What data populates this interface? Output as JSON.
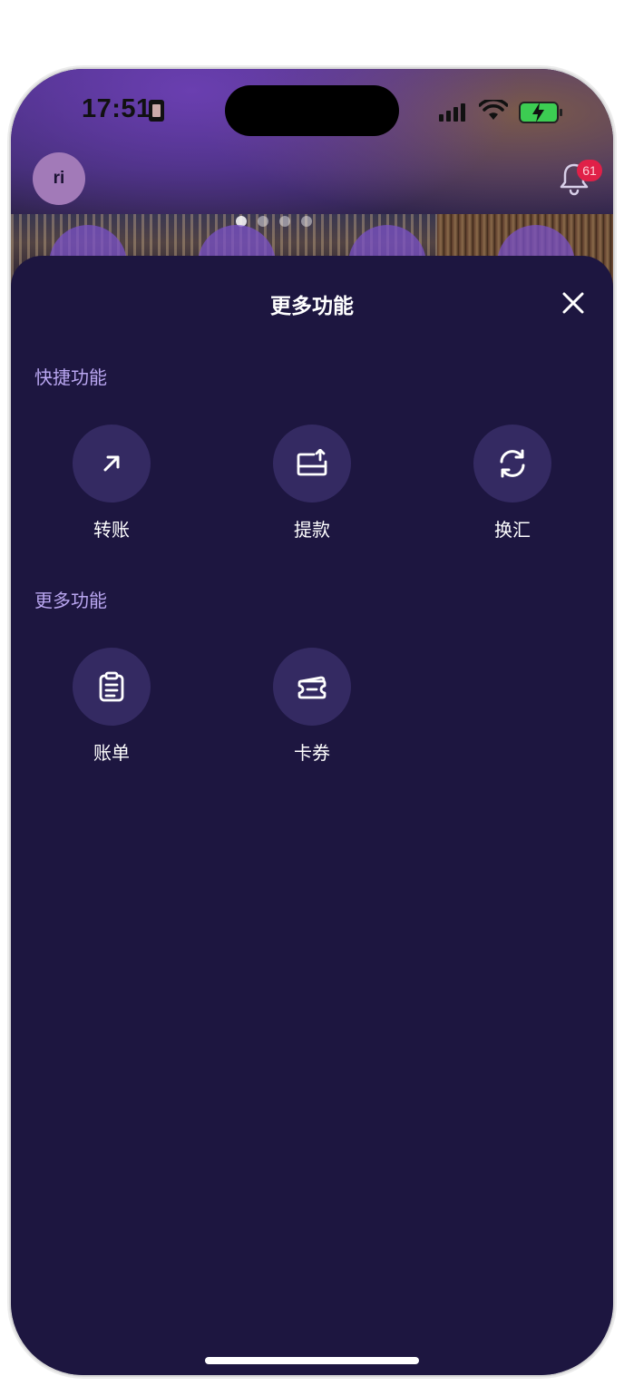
{
  "status_bar": {
    "time": "17:51"
  },
  "header": {
    "avatar_initials": "ri",
    "notification_count": "61"
  },
  "sheet": {
    "title": "更多功能",
    "sections": [
      {
        "title": "快捷功能",
        "items": [
          {
            "label": "转账",
            "icon": "arrow-up-right-icon"
          },
          {
            "label": "提款",
            "icon": "withdraw-icon"
          },
          {
            "label": "换汇",
            "icon": "exchange-icon"
          }
        ]
      },
      {
        "title": "更多功能",
        "items": [
          {
            "label": "账单",
            "icon": "clipboard-icon"
          },
          {
            "label": "卡券",
            "icon": "ticket-icon"
          }
        ]
      }
    ]
  },
  "colors": {
    "sheet_background": "#1d1640",
    "icon_circle": "#342a62",
    "section_title": "#b9a6f0",
    "badge": "#e02048",
    "avatar": "#a27ab8"
  }
}
